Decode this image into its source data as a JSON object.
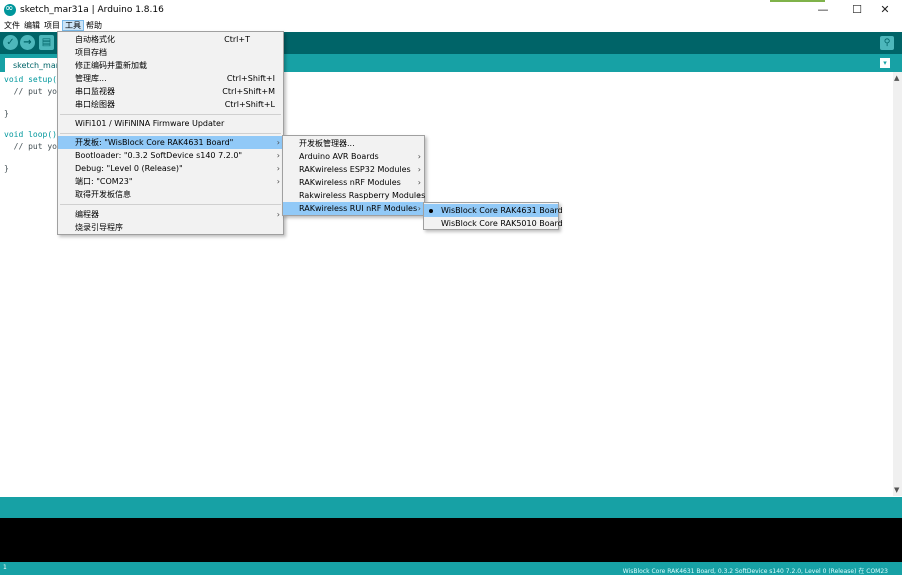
{
  "window": {
    "title": "sketch_mar31a | Arduino 1.8.16",
    "minimize": "—",
    "maximize": "☐",
    "close": "✕"
  },
  "menubar": {
    "items": [
      "文件",
      "编辑",
      "项目",
      "工具",
      "帮助"
    ],
    "active": "工具"
  },
  "toolbar": {
    "verify_icon": "✓",
    "upload_icon": "→",
    "new_icon": "▤",
    "serial_icon": "⚲"
  },
  "tabs": {
    "active": "sketch_mar3",
    "menu_icon": "▾"
  },
  "editor": {
    "lines": [
      "void setup(",
      "  // put yo",
      "}",
      "void loop()",
      "  // put yo",
      "}"
    ]
  },
  "tools_menu": {
    "items": [
      {
        "label": "自动格式化",
        "shortcut": "Ctrl+T"
      },
      {
        "label": "项目存档",
        "shortcut": ""
      },
      {
        "label": "修正编码并重新加载",
        "shortcut": ""
      },
      {
        "label": "管理库...",
        "shortcut": "Ctrl+Shift+I"
      },
      {
        "label": "串口监视器",
        "shortcut": "Ctrl+Shift+M"
      },
      {
        "label": "串口绘图器",
        "shortcut": "Ctrl+Shift+L"
      },
      {
        "label": "WiFi101 / WiFiNINA Firmware Updater",
        "shortcut": ""
      },
      {
        "label": "开发板: \"WisBlock Core RAK4631 Board\"",
        "shortcut": ""
      },
      {
        "label": "Bootloader: \"0.3.2 SoftDevice s140 7.2.0\"",
        "shortcut": ""
      },
      {
        "label": "Debug: \"Level 0 (Release)\"",
        "shortcut": ""
      },
      {
        "label": "端口: \"COM23\"",
        "shortcut": ""
      },
      {
        "label": "取得开发板信息",
        "shortcut": ""
      },
      {
        "label": "编程器",
        "shortcut": ""
      },
      {
        "label": "烧录引导程序",
        "shortcut": ""
      }
    ]
  },
  "board_menu": {
    "items": [
      "开发板管理器...",
      "Arduino AVR Boards",
      "RAKwireless ESP32 Modules",
      "RAKwireless nRF Modules",
      "Rakwireless Raspberry Modules",
      "RAKwireless RUI nRF Modules"
    ]
  },
  "rui_menu": {
    "items": [
      "WisBlock Core RAK4631 Board",
      "WisBlock Core RAK5010 Board"
    ],
    "selected": "WisBlock Core RAK4631 Board"
  },
  "statusbar": {
    "line": "1",
    "board": "WisBlock Core RAK4631 Board, 0.3.2 SoftDevice s140 7.2.0, Level 0 (Release) 在 COM23"
  },
  "colors": {
    "toolbar": "#006468",
    "tabstrip": "#17a1a5",
    "highlight": "#91c9f7"
  }
}
